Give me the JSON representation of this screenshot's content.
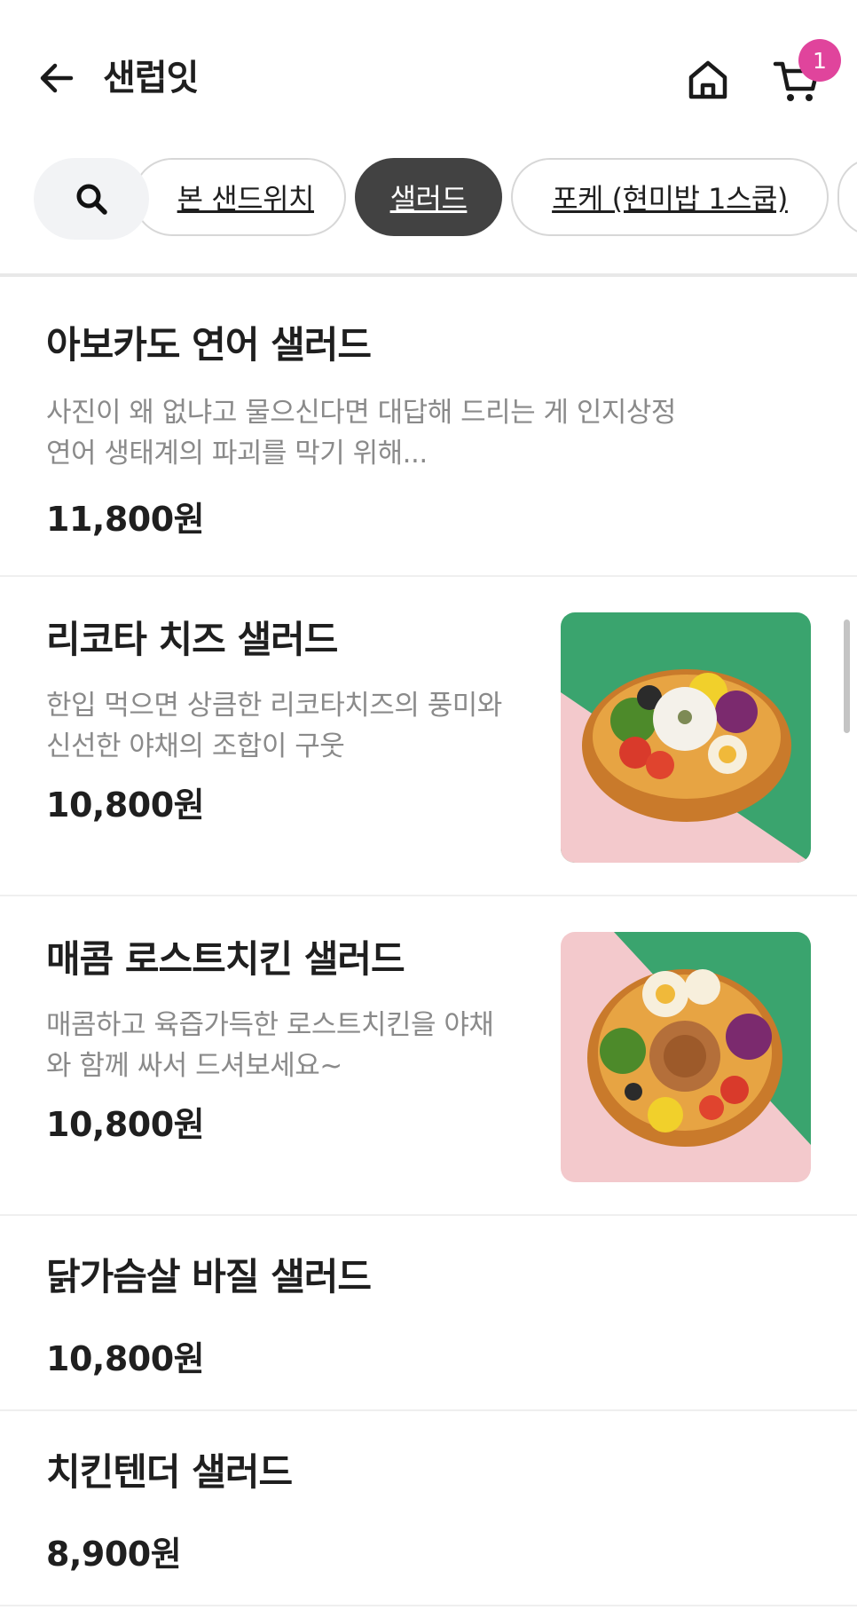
{
  "header": {
    "title": "샌럽잇",
    "cart_count": "1"
  },
  "categories": {
    "items": [
      "본 샌드위치",
      "샐러드",
      "포케 (현미밥 1스쿱)",
      ""
    ],
    "active": "샐러드"
  },
  "menu": [
    {
      "name": "아보카도 연어 샐러드",
      "desc_line1": "사진이 왜 없냐고 물으신다면 대답해 드리는 게 인지상정",
      "desc_line2": "연어 생태계의 파괴를 막기 위해...",
      "price": "11,800원"
    },
    {
      "name": "리코타 치즈 샐러드",
      "desc_line1": "한입 먹으면 상큼한 리코타치즈의 풍미와",
      "desc_line2": "신선한 야채의 조합이 구웃",
      "price": "10,800원"
    },
    {
      "name": "매콤 로스트치킨 샐러드",
      "desc_line1": "매콤하고 육즙가득한 로스트치킨을 야채",
      "desc_line2": "와 함께 싸서 드셔보세요~",
      "price": "10,800원"
    },
    {
      "name": "닭가슴살 바질 샐러드",
      "price": "10,800원"
    },
    {
      "name": "치킨텐더 샐러드",
      "price": "8,900원"
    }
  ],
  "colors": {
    "accent_badge": "#e0449c",
    "active_chip": "#424242",
    "photo_green": "#3aa46e",
    "photo_pink": "#f3c9cc"
  },
  "icons": [
    "back-arrow-icon",
    "home-icon",
    "cart-icon",
    "search-icon"
  ]
}
